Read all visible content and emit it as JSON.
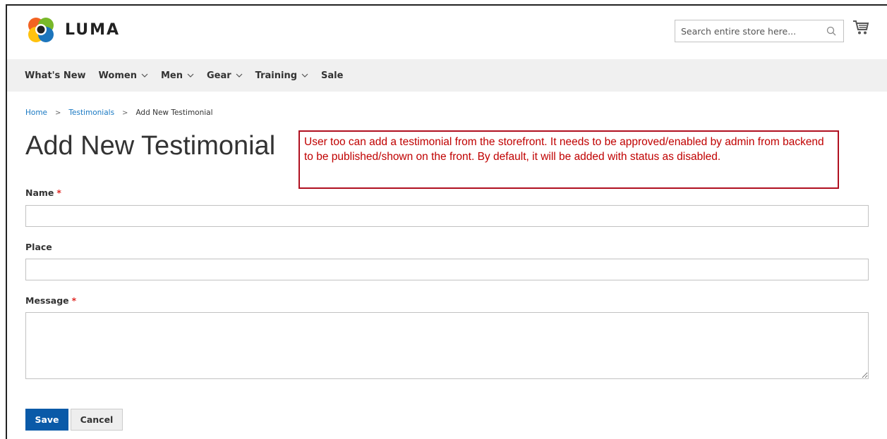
{
  "header": {
    "logo_text": "LUMA",
    "search_placeholder": "Search entire store here..."
  },
  "nav": {
    "items": [
      {
        "label": "What's New",
        "has_dropdown": false
      },
      {
        "label": "Women",
        "has_dropdown": true
      },
      {
        "label": "Men",
        "has_dropdown": true
      },
      {
        "label": "Gear",
        "has_dropdown": true
      },
      {
        "label": "Training",
        "has_dropdown": true
      },
      {
        "label": "Sale",
        "has_dropdown": false
      }
    ]
  },
  "breadcrumb": {
    "home": "Home",
    "separator": ">",
    "section": "Testimonials",
    "current": "Add New Testimonial"
  },
  "page": {
    "title": "Add New Testimonial",
    "annotation": "User too can add a testimonial from the storefront. It needs to be approved/enabled by admin from backend to be published/shown on the front. By default, it will be added with status as disabled."
  },
  "form": {
    "name_label": "Name",
    "place_label": "Place",
    "message_label": "Message",
    "required_marker": "*",
    "name_value": "",
    "place_value": "",
    "message_value": "",
    "save_label": "Save",
    "cancel_label": "Cancel"
  },
  "colors": {
    "accent": "#0a5aa8",
    "link": "#1979c3",
    "annotation_red": "#c00000",
    "required_red": "#e02b27"
  }
}
